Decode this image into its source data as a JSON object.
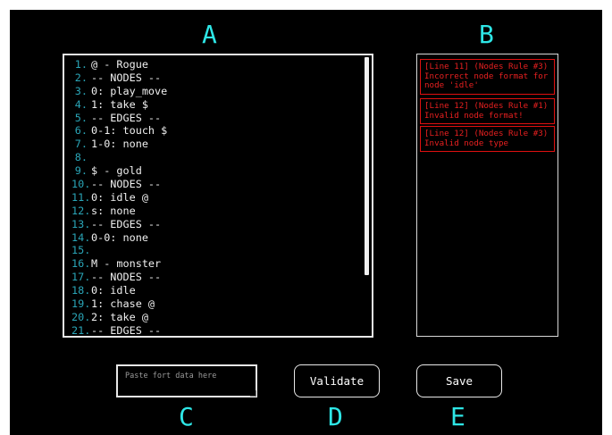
{
  "section_letters": {
    "a": "A",
    "b": "B",
    "c": "C",
    "d": "D",
    "e": "E"
  },
  "editor": {
    "lines": [
      {
        "num": "1.",
        "text": "@ - Rogue"
      },
      {
        "num": "2.",
        "text": "-- NODES --"
      },
      {
        "num": "3.",
        "text": "0: play_move"
      },
      {
        "num": "4.",
        "text": "1: take $"
      },
      {
        "num": "5.",
        "text": "-- EDGES --"
      },
      {
        "num": "6.",
        "text": "0-1: touch $"
      },
      {
        "num": "7.",
        "text": "1-0: none"
      },
      {
        "num": "8.",
        "text": ""
      },
      {
        "num": "9.",
        "text": "$ - gold"
      },
      {
        "num": "10.",
        "text": "-- NODES --"
      },
      {
        "num": "11.",
        "text": "0: idle @"
      },
      {
        "num": "12.",
        "text": "s: none"
      },
      {
        "num": "13.",
        "text": "-- EDGES --"
      },
      {
        "num": "14.",
        "text": "0-0: none"
      },
      {
        "num": "15.",
        "text": ""
      },
      {
        "num": "16.",
        "text": "M - monster"
      },
      {
        "num": "17.",
        "text": "-- NODES --"
      },
      {
        "num": "18.",
        "text": "0: idle"
      },
      {
        "num": "19.",
        "text": "1: chase @"
      },
      {
        "num": "20.",
        "text": "2: take @"
      },
      {
        "num": "21.",
        "text": "-- EDGES --"
      }
    ]
  },
  "errors": [
    {
      "text": "[Line 11] (Nodes Rule #3)\nIncorrect node format for\nnode 'idle'"
    },
    {
      "text": "[Line 12] (Nodes Rule #1)\nInvalid node format!"
    },
    {
      "text": "[Line 12] (Nodes Rule #3)\nInvalid node type"
    }
  ],
  "paste_input": {
    "placeholder": "Paste fort data here",
    "value": ""
  },
  "buttons": {
    "validate": "Validate",
    "save": "Save"
  },
  "colors": {
    "letters": "#2ee6e6",
    "line_numbers": "#2aa6b8",
    "error": "#e82020",
    "background": "#000000"
  }
}
